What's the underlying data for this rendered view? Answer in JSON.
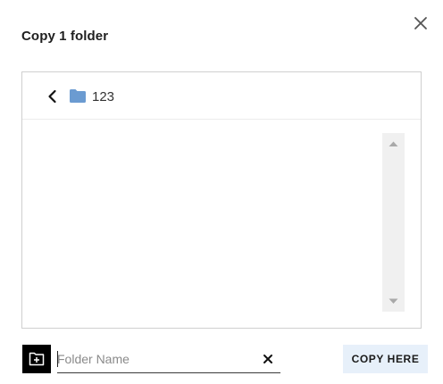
{
  "dialog": {
    "title": "Copy 1 folder",
    "close_icon": "close-icon"
  },
  "browser": {
    "back_icon": "chevron-left-icon",
    "folder_icon": "folder-icon",
    "current_folder": "123",
    "folder_color": "#6b9bd1",
    "items": []
  },
  "footer": {
    "new_folder_icon": "new-folder-icon",
    "folder_name_value": "",
    "folder_name_placeholder": "Folder Name",
    "clear_icon": "clear-icon",
    "copy_here_label": "COPY HERE",
    "copy_here_bg": "#e7f0fa"
  }
}
